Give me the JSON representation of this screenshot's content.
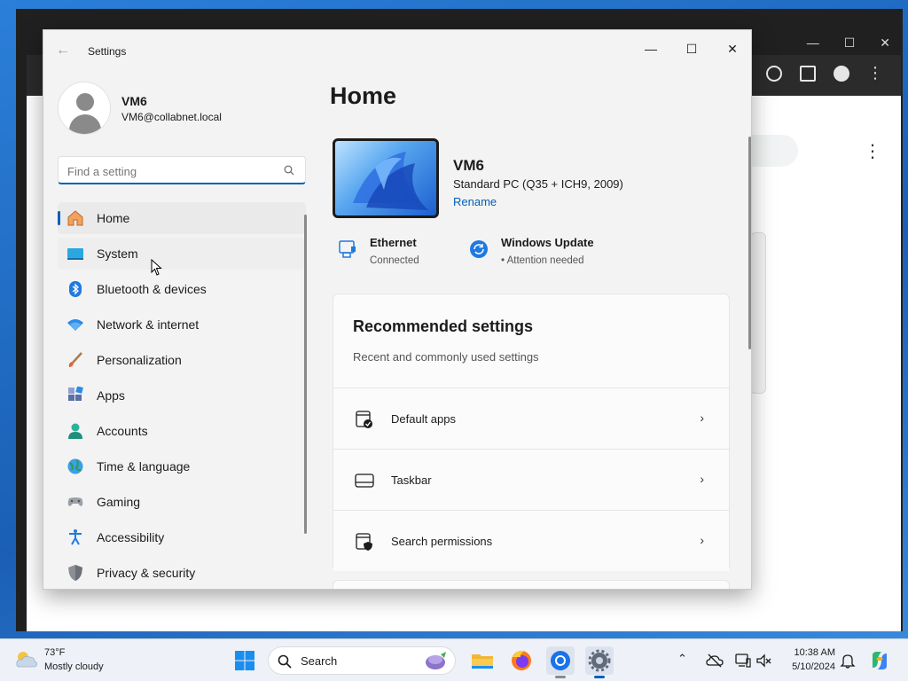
{
  "window": {
    "title": "Settings"
  },
  "user": {
    "name": "VM6",
    "email": "VM6@collabnet.local"
  },
  "search": {
    "placeholder": "Find a setting"
  },
  "nav": {
    "items": [
      {
        "label": "Home",
        "icon": "home-icon"
      },
      {
        "label": "System",
        "icon": "system-icon"
      },
      {
        "label": "Bluetooth & devices",
        "icon": "bluetooth-icon"
      },
      {
        "label": "Network & internet",
        "icon": "wifi-icon"
      },
      {
        "label": "Personalization",
        "icon": "brush-icon"
      },
      {
        "label": "Apps",
        "icon": "apps-icon"
      },
      {
        "label": "Accounts",
        "icon": "accounts-icon"
      },
      {
        "label": "Time & language",
        "icon": "globe-icon"
      },
      {
        "label": "Gaming",
        "icon": "gamepad-icon"
      },
      {
        "label": "Accessibility",
        "icon": "accessibility-icon"
      },
      {
        "label": "Privacy & security",
        "icon": "shield-icon"
      }
    ],
    "active": "Home"
  },
  "main": {
    "title": "Home",
    "device": {
      "name": "VM6",
      "model": "Standard PC (Q35 + ICH9, 2009)",
      "rename_label": "Rename"
    },
    "status": [
      {
        "title": "Ethernet",
        "sub": "Connected",
        "icon": "ethernet-icon"
      },
      {
        "title": "Windows Update",
        "sub": "• Attention needed",
        "icon": "update-icon"
      }
    ],
    "recommended": {
      "title": "Recommended settings",
      "subtitle": "Recent and commonly used settings",
      "rows": [
        {
          "label": "Default apps",
          "icon": "default-apps-icon"
        },
        {
          "label": "Taskbar",
          "icon": "taskbar-icon"
        },
        {
          "label": "Search permissions",
          "icon": "search-permissions-icon"
        }
      ]
    }
  },
  "taskbar": {
    "weather": {
      "temp": "73°F",
      "condition": "Mostly cloudy"
    },
    "search_label": "Search",
    "clock": {
      "time": "10:38 AM",
      "date": "5/10/2024"
    }
  },
  "colors": {
    "accent": "#005fb8",
    "window_bg": "#f3f3f3",
    "taskbar_bg": "#eef1f7"
  }
}
